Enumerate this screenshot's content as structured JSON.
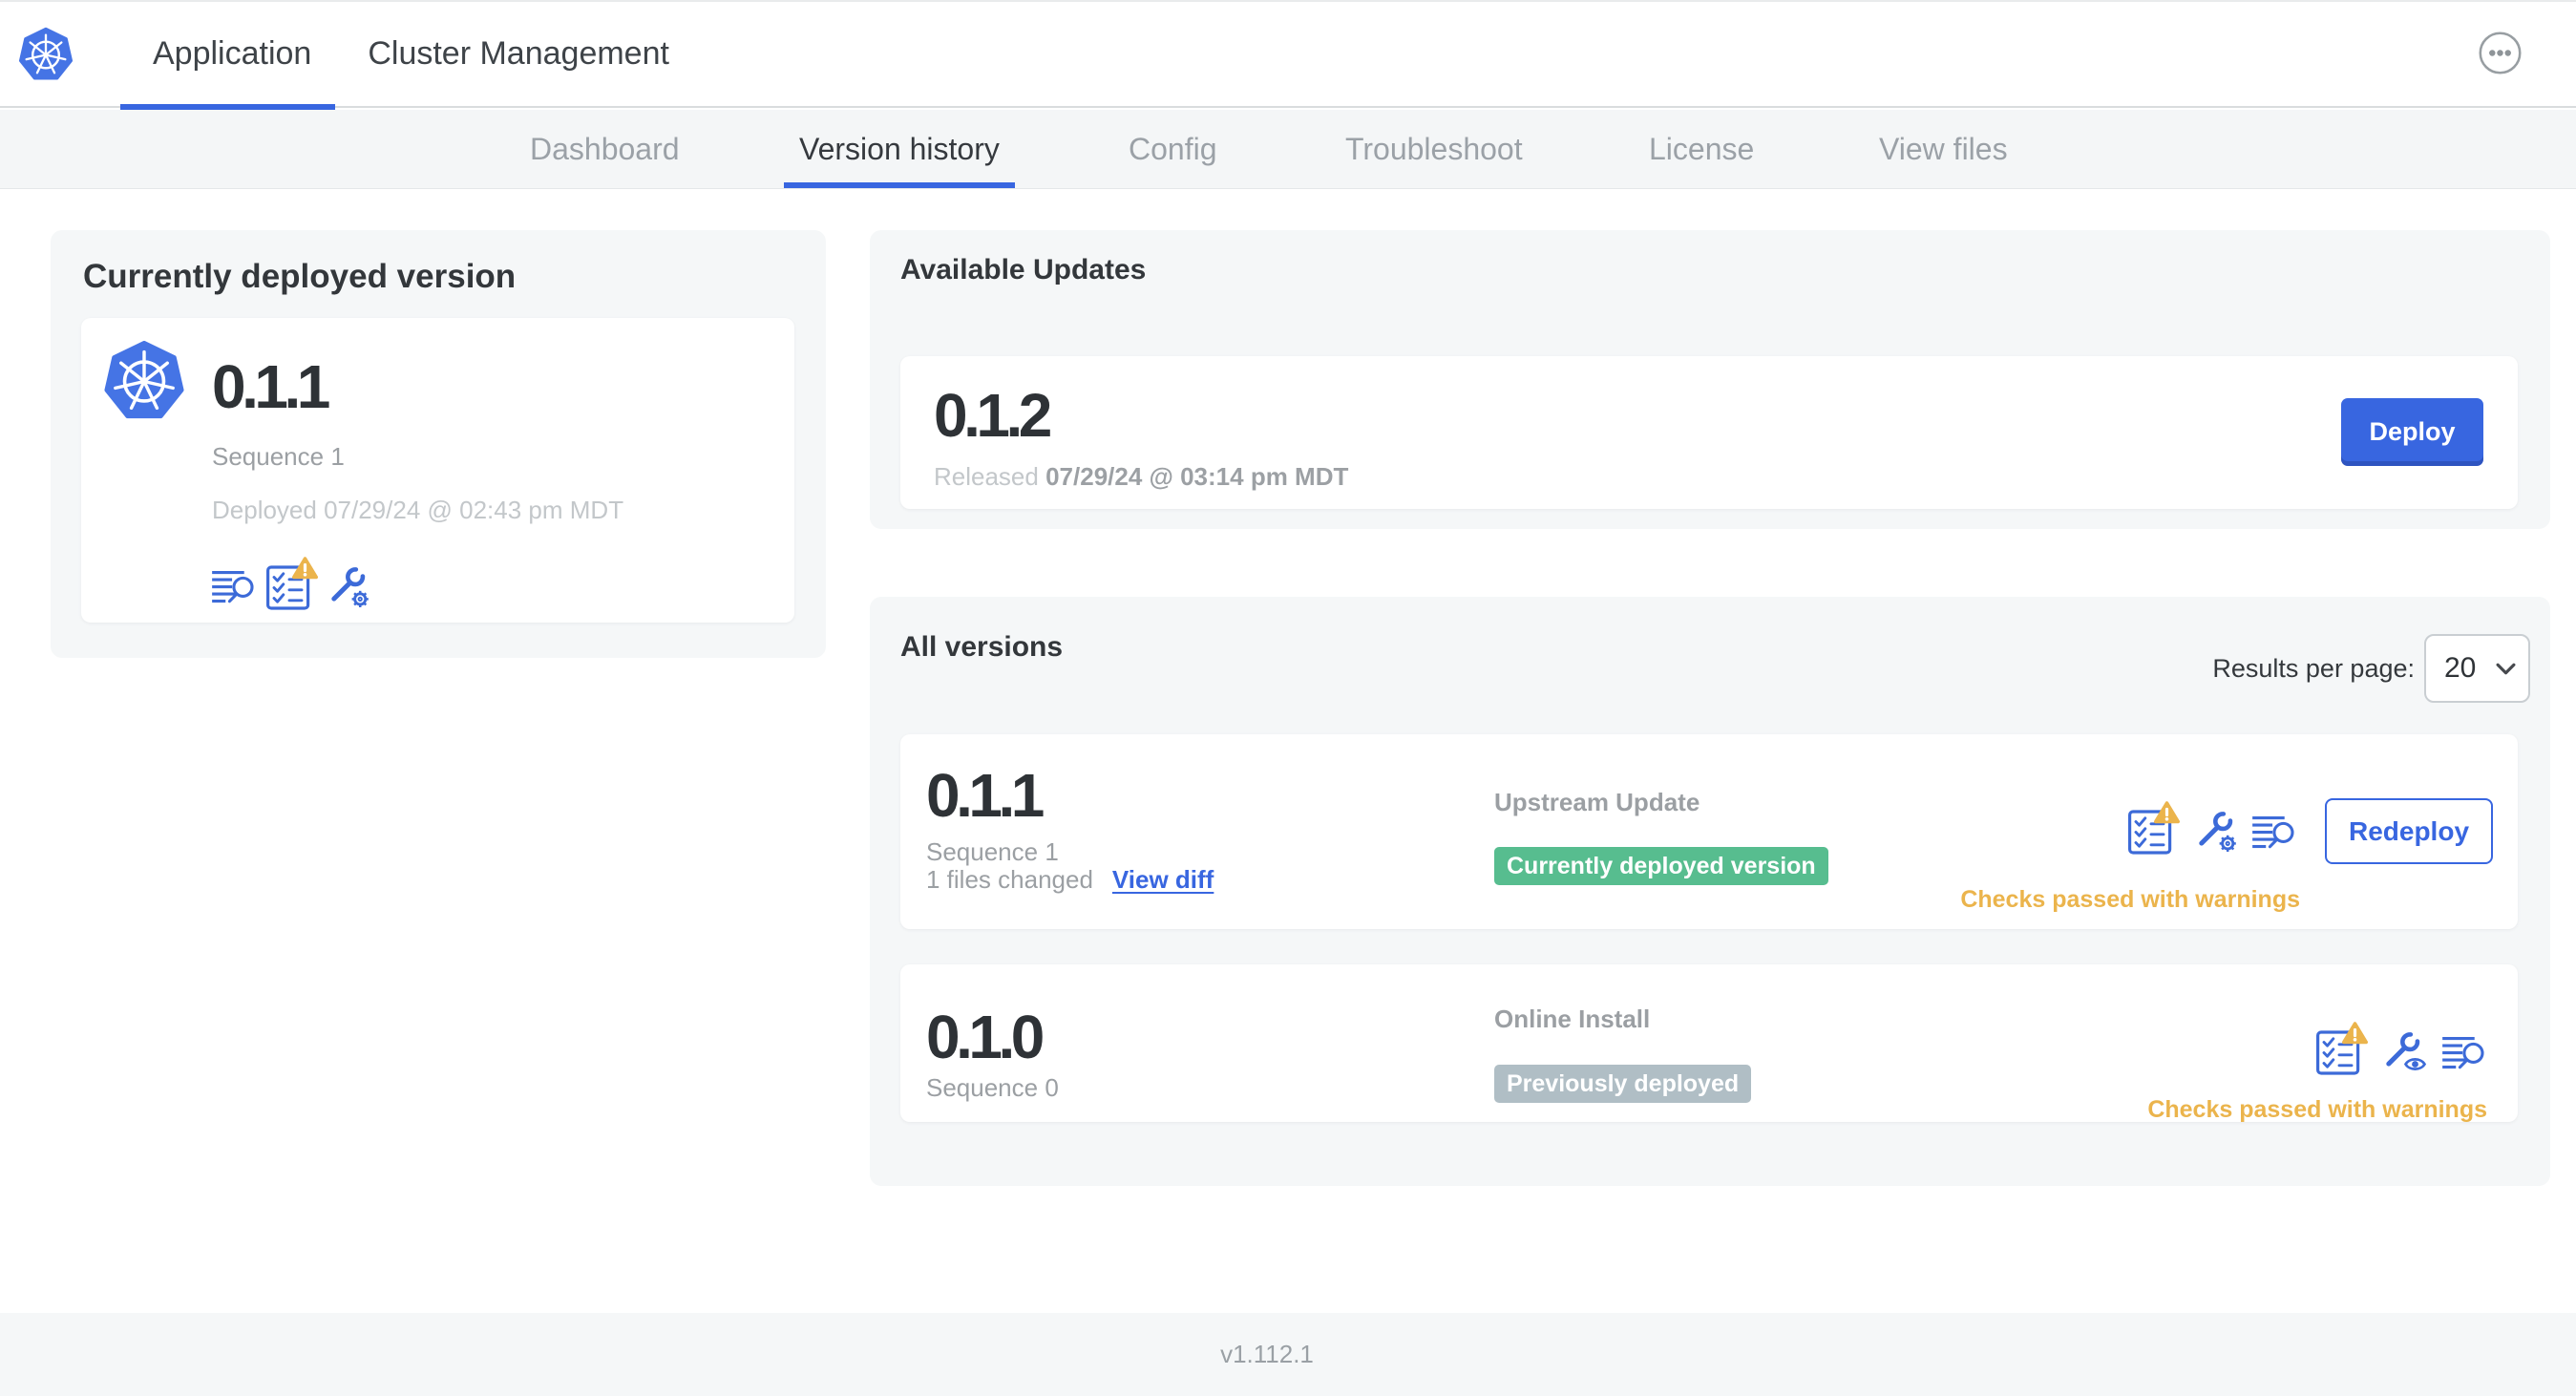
{
  "colors": {
    "accent_blue": "#3866e0",
    "icon_blue": "#3c6ad8",
    "kubernetes_logo_blue": "#4574e5",
    "warning_amber": "#ebb44c",
    "success_green": "#57bd8f",
    "neutral_badge_gray": "#b0bec5",
    "panel_gray": "#f5f7f8"
  },
  "header": {
    "logo_icon": "kubernetes-logo",
    "tabs": [
      {
        "label": "Application",
        "active": true
      },
      {
        "label": "Cluster Management",
        "active": false
      }
    ],
    "overflow_menu_icon": "ellipsis-icon"
  },
  "subnav": {
    "tabs": [
      {
        "label": "Dashboard",
        "active": false
      },
      {
        "label": "Version history",
        "active": true
      },
      {
        "label": "Config",
        "active": false
      },
      {
        "label": "Troubleshoot",
        "active": false
      },
      {
        "label": "License",
        "active": false
      },
      {
        "label": "View files",
        "active": false
      }
    ]
  },
  "current_version": {
    "title": "Currently deployed version",
    "app_icon": "kubernetes-logo",
    "version": "0.1.1",
    "sequence": "Sequence 1",
    "deployed": "Deployed 07/29/24 @ 02:43 pm MDT",
    "icons": [
      "view-logs-icon",
      "preflight-checks-warning-icon",
      "config-gear-icon"
    ]
  },
  "available_updates": {
    "title": "Available Updates",
    "update": {
      "version": "0.1.2",
      "released_prefix": "Released",
      "released_date": "07/29/24 @ 03:14 pm MDT",
      "deploy_button": "Deploy"
    }
  },
  "all_versions": {
    "title": "All versions",
    "results_per_page_label": "Results per page:",
    "results_per_page_value": "20",
    "rows": [
      {
        "version": "0.1.1",
        "sequence": "Sequence 1",
        "files_changed": "1 files changed",
        "view_diff_link": "View diff",
        "source": "Upstream Update",
        "status_badge": "Currently deployed version",
        "badge_style": "success",
        "icons": [
          "preflight-checks-warning-icon",
          "config-gear-icon",
          "view-logs-icon"
        ],
        "action_button": "Redeploy",
        "check_status": "Checks passed with warnings"
      },
      {
        "version": "0.1.0",
        "sequence": "Sequence 0",
        "source": "Online Install",
        "status_badge": "Previously deployed",
        "badge_style": "neutral",
        "icons": [
          "preflight-checks-warning-icon",
          "view-config-eye-icon",
          "view-logs-icon"
        ],
        "check_status": "Checks passed with warnings"
      }
    ]
  },
  "footer": {
    "version": "v1.112.1"
  }
}
